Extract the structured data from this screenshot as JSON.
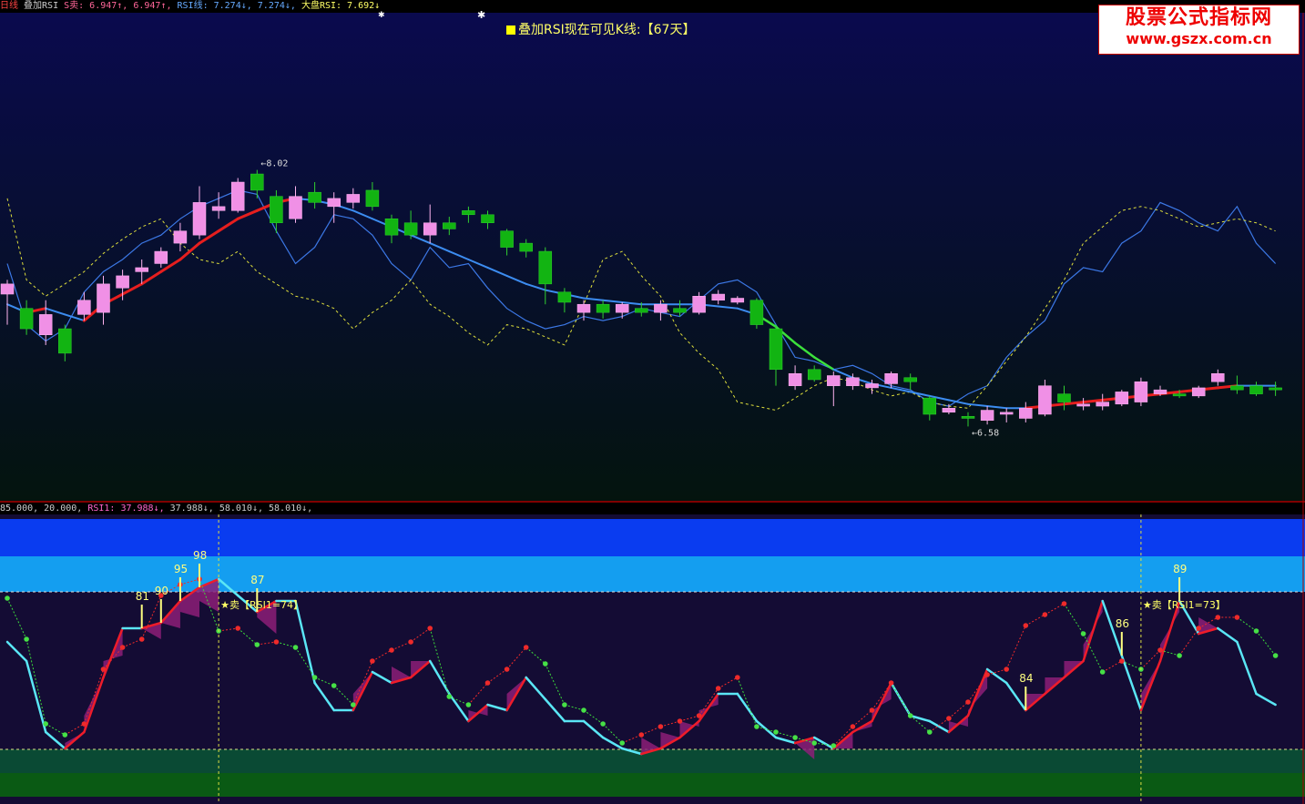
{
  "header": {
    "upper_legend": [
      {
        "text": "日线",
        "color": "#ff4444"
      },
      {
        "text": "叠加RSI",
        "color": "#cccccc"
      },
      {
        "text": "S卖: 6.947↑, 6.947↑,",
        "color": "#ff6699"
      },
      {
        "text": "RSI线: 7.274↓, 7.274↓,",
        "color": "#66aaff"
      },
      {
        "text": "大盘RSI: 7.692↓",
        "color": "#ffff66"
      }
    ],
    "lower_legend": [
      {
        "text": "85.000, 20.000,",
        "color": "#cccccc"
      },
      {
        "text": "RSI1: 37.988↓,",
        "color": "#ff66cc"
      },
      {
        "text": "37.988↓, 58.010↓, 58.010↓,",
        "color": "#cccccc"
      }
    ],
    "title": "叠加RSI现在可见K线:【67天】"
  },
  "logo": {
    "line1": "股票公式指标网",
    "line2": "www.gszx.com.cn"
  },
  "chart_data": [
    {
      "type": "candlestick",
      "panel": "upper",
      "high_marker": "8.02",
      "low_marker": "6.58",
      "candles": [
        {
          "o": 7.55,
          "c": 7.6,
          "h": 7.62,
          "l": 7.4
        },
        {
          "o": 7.48,
          "c": 7.38,
          "h": 7.52,
          "l": 7.35
        },
        {
          "o": 7.35,
          "c": 7.45,
          "h": 7.52,
          "l": 7.3
        },
        {
          "o": 7.38,
          "c": 7.26,
          "h": 7.4,
          "l": 7.22
        },
        {
          "o": 7.45,
          "c": 7.52,
          "h": 7.56,
          "l": 7.42
        },
        {
          "o": 7.46,
          "c": 7.6,
          "h": 7.64,
          "l": 7.4
        },
        {
          "o": 7.58,
          "c": 7.64,
          "h": 7.67,
          "l": 7.52
        },
        {
          "o": 7.66,
          "c": 7.68,
          "h": 7.72,
          "l": 7.6
        },
        {
          "o": 7.7,
          "c": 7.76,
          "h": 7.78,
          "l": 7.68
        },
        {
          "o": 7.8,
          "c": 7.86,
          "h": 7.9,
          "l": 7.76
        },
        {
          "o": 7.84,
          "c": 8.0,
          "h": 8.08,
          "l": 7.82
        },
        {
          "o": 7.96,
          "c": 7.98,
          "h": 8.05,
          "l": 7.92
        },
        {
          "o": 7.96,
          "c": 8.1,
          "h": 8.12,
          "l": 7.95
        },
        {
          "o": 8.14,
          "c": 8.06,
          "h": 8.16,
          "l": 8.02
        },
        {
          "o": 8.03,
          "c": 7.9,
          "h": 8.06,
          "l": 7.85
        },
        {
          "o": 7.92,
          "c": 8.03,
          "h": 8.08,
          "l": 7.9
        },
        {
          "o": 8.05,
          "c": 8.0,
          "h": 8.1,
          "l": 7.97
        },
        {
          "o": 7.98,
          "c": 8.02,
          "h": 8.05,
          "l": 7.9
        },
        {
          "o": 8.0,
          "c": 8.04,
          "h": 8.07,
          "l": 7.97
        },
        {
          "o": 8.06,
          "c": 7.98,
          "h": 8.1,
          "l": 7.96
        },
        {
          "o": 7.92,
          "c": 7.84,
          "h": 7.94,
          "l": 7.8
        },
        {
          "o": 7.9,
          "c": 7.84,
          "h": 7.96,
          "l": 7.82
        },
        {
          "o": 7.84,
          "c": 7.9,
          "h": 7.99,
          "l": 7.8
        },
        {
          "o": 7.9,
          "c": 7.87,
          "h": 7.93,
          "l": 7.84
        },
        {
          "o": 7.96,
          "c": 7.94,
          "h": 7.98,
          "l": 7.9
        },
        {
          "o": 7.94,
          "c": 7.9,
          "h": 7.96,
          "l": 7.87
        },
        {
          "o": 7.86,
          "c": 7.78,
          "h": 7.87,
          "l": 7.74
        },
        {
          "o": 7.8,
          "c": 7.76,
          "h": 7.82,
          "l": 7.73
        },
        {
          "o": 7.76,
          "c": 7.6,
          "h": 7.78,
          "l": 7.5
        },
        {
          "o": 7.56,
          "c": 7.51,
          "h": 7.58,
          "l": 7.46
        },
        {
          "o": 7.46,
          "c": 7.5,
          "h": 7.52,
          "l": 7.42
        },
        {
          "o": 7.5,
          "c": 7.46,
          "h": 7.52,
          "l": 7.43
        },
        {
          "o": 7.46,
          "c": 7.5,
          "h": 7.51,
          "l": 7.43
        },
        {
          "o": 7.48,
          "c": 7.46,
          "h": 7.51,
          "l": 7.44
        },
        {
          "o": 7.46,
          "c": 7.5,
          "h": 7.52,
          "l": 7.42
        },
        {
          "o": 7.48,
          "c": 7.46,
          "h": 7.52,
          "l": 7.44
        },
        {
          "o": 7.46,
          "c": 7.54,
          "h": 7.56,
          "l": 7.45
        },
        {
          "o": 7.52,
          "c": 7.55,
          "h": 7.57,
          "l": 7.5
        },
        {
          "o": 7.51,
          "c": 7.53,
          "h": 7.54,
          "l": 7.5
        },
        {
          "o": 7.52,
          "c": 7.4,
          "h": 7.53,
          "l": 7.38
        },
        {
          "o": 7.38,
          "c": 7.18,
          "h": 7.4,
          "l": 7.1
        },
        {
          "o": 7.1,
          "c": 7.16,
          "h": 7.2,
          "l": 7.08
        },
        {
          "o": 7.18,
          "c": 7.13,
          "h": 7.2,
          "l": 7.12
        },
        {
          "o": 7.1,
          "c": 7.15,
          "h": 7.17,
          "l": 7.0
        },
        {
          "o": 7.1,
          "c": 7.14,
          "h": 7.16,
          "l": 7.08
        },
        {
          "o": 7.09,
          "c": 7.11,
          "h": 7.13,
          "l": 7.06
        },
        {
          "o": 7.11,
          "c": 7.16,
          "h": 7.17,
          "l": 7.09
        },
        {
          "o": 7.14,
          "c": 7.12,
          "h": 7.16,
          "l": 7.08
        },
        {
          "o": 7.04,
          "c": 6.96,
          "h": 7.05,
          "l": 6.93
        },
        {
          "o": 6.97,
          "c": 6.99,
          "h": 7.01,
          "l": 6.96
        },
        {
          "o": 6.95,
          "c": 6.94,
          "h": 6.97,
          "l": 6.9
        },
        {
          "o": 6.93,
          "c": 6.98,
          "h": 7.0,
          "l": 6.91
        },
        {
          "o": 6.96,
          "c": 6.97,
          "h": 6.99,
          "l": 6.92
        },
        {
          "o": 6.94,
          "c": 6.99,
          "h": 7.02,
          "l": 6.92
        },
        {
          "o": 6.96,
          "c": 7.1,
          "h": 7.13,
          "l": 6.95
        },
        {
          "o": 7.06,
          "c": 7.02,
          "h": 7.1,
          "l": 6.98
        },
        {
          "o": 7.0,
          "c": 7.01,
          "h": 7.04,
          "l": 6.98
        },
        {
          "o": 7.0,
          "c": 7.02,
          "h": 7.06,
          "l": 6.98
        },
        {
          "o": 7.01,
          "c": 7.07,
          "h": 7.08,
          "l": 7.0
        },
        {
          "o": 7.02,
          "c": 7.12,
          "h": 7.14,
          "l": 7.0
        },
        {
          "o": 7.06,
          "c": 7.08,
          "h": 7.1,
          "l": 7.05
        },
        {
          "o": 7.06,
          "c": 7.05,
          "h": 7.08,
          "l": 7.04
        },
        {
          "o": 7.05,
          "c": 7.09,
          "h": 7.1,
          "l": 7.04
        },
        {
          "o": 7.12,
          "c": 7.16,
          "h": 7.18,
          "l": 7.1
        },
        {
          "o": 7.1,
          "c": 7.08,
          "h": 7.15,
          "l": 7.06
        },
        {
          "o": 7.1,
          "c": 7.06,
          "h": 7.12,
          "l": 7.05
        },
        {
          "o": 7.09,
          "c": 7.08,
          "h": 7.12,
          "l": 7.05
        }
      ],
      "series": [
        {
          "values": [
            7.5,
            7.46,
            7.48,
            7.45,
            7.42,
            7.5,
            7.55,
            7.6,
            7.66,
            7.72,
            7.8,
            7.86,
            7.92,
            7.96,
            8.0,
            8.02,
            8.01,
            7.99,
            7.96,
            7.92,
            7.88,
            7.84,
            7.8,
            7.76,
            7.72,
            7.68,
            7.64,
            7.6,
            7.57,
            7.55,
            7.53,
            7.52,
            7.51,
            7.5,
            7.5,
            7.5,
            7.5,
            7.49,
            7.48,
            7.45,
            7.39,
            7.31,
            7.24,
            7.18,
            7.14,
            7.11,
            7.09,
            7.07,
            7.05,
            7.03,
            7.01,
            7.0,
            6.99,
            6.99,
            7.0,
            7.01,
            7.02,
            7.03,
            7.04,
            7.05,
            7.06,
            7.07,
            7.08,
            7.09,
            7.1,
            7.1,
            7.1
          ]
        },
        {
          "values": [
            7.7,
            7.4,
            7.32,
            7.38,
            7.56,
            7.66,
            7.72,
            7.8,
            7.84,
            7.92,
            7.98,
            8.02,
            8.06,
            8.04,
            7.86,
            7.7,
            7.78,
            7.94,
            7.92,
            7.84,
            7.7,
            7.62,
            7.78,
            7.68,
            7.7,
            7.58,
            7.48,
            7.42,
            7.38,
            7.4,
            7.44,
            7.42,
            7.44,
            7.48,
            7.46,
            7.44,
            7.52,
            7.6,
            7.62,
            7.56,
            7.4,
            7.24,
            7.22,
            7.18,
            7.2,
            7.16,
            7.1,
            7.08,
            7.02,
            7.0,
            7.06,
            7.1,
            7.24,
            7.34,
            7.42,
            7.6,
            7.68,
            7.66,
            7.8,
            7.86,
            8.0,
            7.96,
            7.9,
            7.86,
            7.98,
            7.8,
            7.7
          ]
        },
        {
          "values": [
            8.02,
            7.62,
            7.54,
            7.6,
            7.66,
            7.75,
            7.82,
            7.88,
            7.92,
            7.8,
            7.72,
            7.7,
            7.76,
            7.66,
            7.6,
            7.54,
            7.52,
            7.48,
            7.38,
            7.46,
            7.52,
            7.62,
            7.5,
            7.44,
            7.36,
            7.3,
            7.4,
            7.38,
            7.34,
            7.3,
            7.5,
            7.72,
            7.76,
            7.64,
            7.54,
            7.36,
            7.26,
            7.18,
            7.02,
            7.0,
            6.98,
            7.04,
            7.1,
            7.14,
            7.12,
            7.08,
            7.05,
            7.07,
            7.02,
            7.0,
            6.99,
            7.1,
            7.22,
            7.34,
            7.48,
            7.62,
            7.8,
            7.88,
            7.96,
            7.98,
            7.96,
            7.92,
            7.88,
            7.9,
            7.92,
            7.9,
            7.86
          ]
        }
      ]
    },
    {
      "type": "line",
      "panel": "lower",
      "ylim": [
        0,
        100
      ],
      "levels": [
        85,
        20
      ],
      "rsi1": [
        55,
        48,
        22,
        16,
        22,
        42,
        60,
        60,
        62,
        70,
        75,
        78,
        72,
        66,
        70,
        70,
        40,
        30,
        30,
        44,
        40,
        42,
        48,
        36,
        26,
        32,
        30,
        42,
        34,
        26,
        26,
        20,
        16,
        14,
        16,
        20,
        26,
        36,
        36,
        26,
        20,
        18,
        20,
        16,
        22,
        26,
        40,
        28,
        26,
        22,
        28,
        45,
        40,
        30,
        36,
        42,
        48,
        70,
        50,
        30,
        48,
        70,
        58,
        60,
        55,
        36,
        32
      ],
      "rsi2": [
        66,
        56,
        30,
        18,
        30,
        48,
        56,
        60,
        62,
        66,
        70,
        72,
        70,
        64,
        64,
        66,
        50,
        44,
        46,
        50,
        52,
        56,
        60,
        40,
        30,
        34,
        46,
        60,
        54,
        40,
        38,
        24,
        20,
        20,
        22,
        26,
        30,
        38,
        40,
        30,
        20,
        18,
        18,
        16,
        22,
        30,
        40,
        34,
        30,
        26,
        30,
        44,
        50,
        56,
        60,
        64,
        72,
        72,
        64,
        56,
        60,
        72,
        70,
        70,
        68,
        56,
        52
      ],
      "dots": [
        71,
        56,
        25,
        21,
        25,
        45,
        53,
        56,
        72,
        76,
        78,
        59,
        60,
        54,
        55,
        53,
        42,
        39,
        32,
        48,
        52,
        55,
        60,
        35,
        32,
        40,
        45,
        53,
        47,
        32,
        30,
        25,
        18,
        21,
        24,
        26,
        28,
        38,
        42,
        24,
        22,
        20,
        18,
        17,
        24,
        30,
        40,
        28,
        22,
        27,
        33,
        43,
        45,
        61,
        65,
        69,
        58,
        44,
        48,
        45,
        52,
        50,
        60,
        64,
        64,
        59,
        50
      ],
      "peak_labels": [
        {
          "label": "81",
          "index": 7
        },
        {
          "label": "90",
          "index": 8
        },
        {
          "label": "95",
          "index": 9
        },
        {
          "label": "98",
          "index": 10
        },
        {
          "label": "87",
          "index": 13
        },
        {
          "label": "84",
          "index": 53
        },
        {
          "label": "86",
          "index": 58
        },
        {
          "label": "89",
          "index": 61
        }
      ],
      "sell_signals": [
        {
          "text": "★卖【RSI1=74】",
          "index": 11
        },
        {
          "text": "★卖【RSI1=73】",
          "index": 59
        }
      ]
    }
  ]
}
